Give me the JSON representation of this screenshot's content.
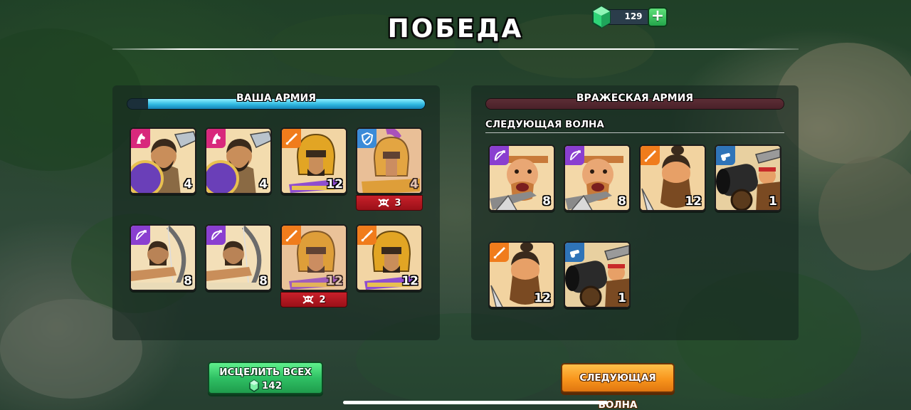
{
  "header": {
    "title": "ПОБЕДА",
    "gems": "129",
    "add_gems_icon": "plus-icon"
  },
  "player_army": {
    "label": "ВАША АРМИЯ",
    "health_fraction": 0.93,
    "units": [
      {
        "type": "cavalry",
        "badge_icon": "horse-icon",
        "badge_color": "#d8287c",
        "count": "4"
      },
      {
        "type": "cavalry",
        "badge_icon": "horse-icon",
        "badge_color": "#d8287c",
        "count": "4"
      },
      {
        "type": "swordsman",
        "badge_icon": "sword-icon",
        "badge_color": "#f07c1c",
        "count": "12"
      },
      {
        "type": "hoplite",
        "badge_icon": "shield-icon",
        "badge_color": "#3b8bd8",
        "count": "4",
        "kills": "3"
      },
      {
        "type": "archer",
        "badge_icon": "bow-icon",
        "badge_color": "#8a3fd0",
        "count": "8"
      },
      {
        "type": "archer",
        "badge_icon": "bow-icon",
        "badge_color": "#8a3fd0",
        "count": "8"
      },
      {
        "type": "swordsman",
        "badge_icon": "sword-icon",
        "badge_color": "#f07c1c",
        "count": "12",
        "kills": "2"
      },
      {
        "type": "swordsman",
        "badge_icon": "sword-icon",
        "badge_color": "#f07c1c",
        "count": "12"
      }
    ]
  },
  "enemy_army": {
    "label": "ВРАЖЕСКАЯ АРМИЯ",
    "next_wave_label": "СЛЕДУЮЩАЯ ВОЛНА",
    "units": [
      {
        "type": "barbarian-archer",
        "badge_icon": "bow-icon",
        "badge_color": "#8a3fd0",
        "count": "8"
      },
      {
        "type": "barbarian-archer",
        "badge_icon": "bow-icon",
        "badge_color": "#8a3fd0",
        "count": "8"
      },
      {
        "type": "barbarian-warrior",
        "badge_icon": "sword-icon",
        "badge_color": "#f07c1c",
        "count": "12"
      },
      {
        "type": "cannon",
        "badge_icon": "cannon-icon",
        "badge_color": "#2f74b8",
        "count": "1"
      },
      {
        "type": "barbarian-warrior",
        "badge_icon": "sword-icon",
        "badge_color": "#f07c1c",
        "count": "12"
      },
      {
        "type": "cannon",
        "badge_icon": "cannon-icon",
        "badge_color": "#2f74b8",
        "count": "1"
      }
    ]
  },
  "actions": {
    "heal_all_label": "ИСЦЕЛИТЬ ВСЕХ",
    "heal_all_cost": "142",
    "next_wave_button": "СЛЕДУЮЩАЯ ВОЛНА"
  }
}
